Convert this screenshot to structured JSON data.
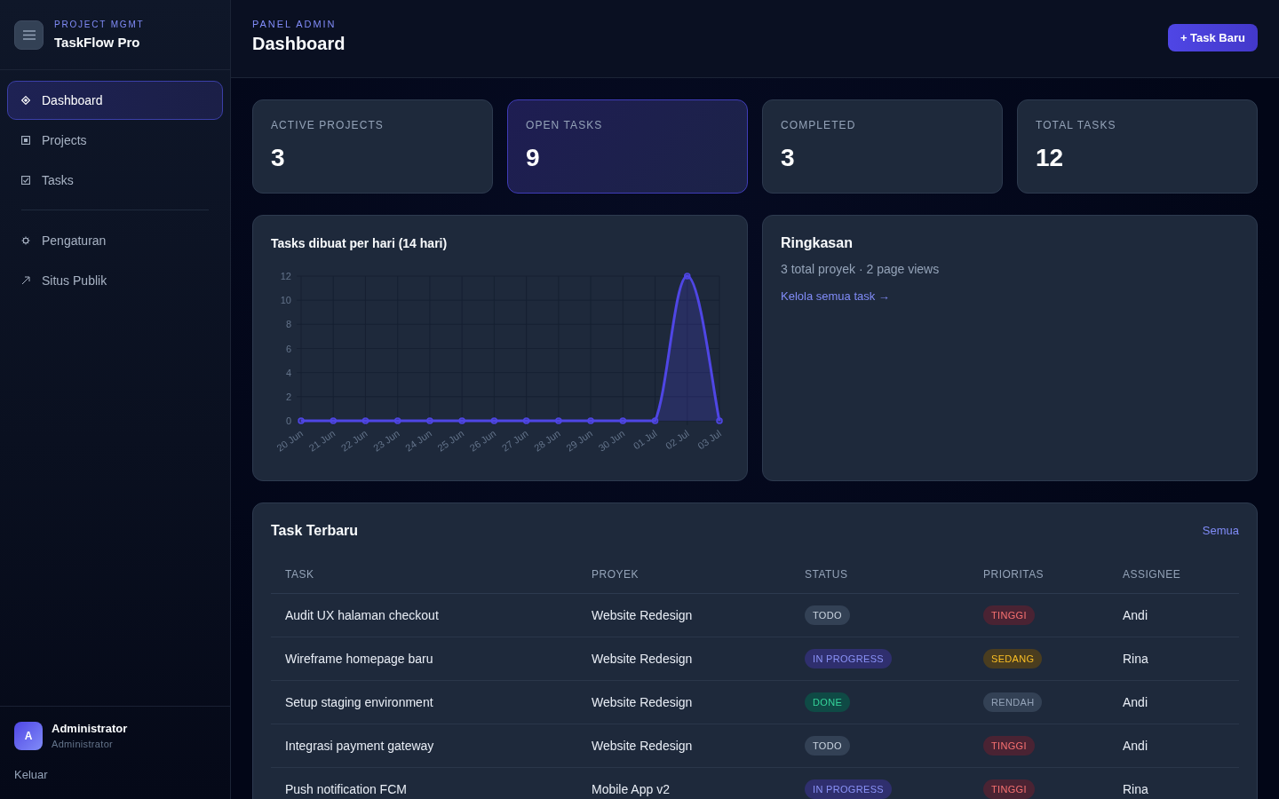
{
  "sidebar": {
    "brand": {
      "eyebrow": "PROJECT MGMT",
      "name": "TaskFlow Pro"
    },
    "nav": [
      {
        "label": "Dashboard",
        "selected": true
      },
      {
        "label": "Projects",
        "selected": false
      },
      {
        "label": "Tasks",
        "selected": false
      }
    ],
    "secondary_nav": [
      {
        "label": "Pengaturan",
        "selected": false
      },
      {
        "label": "Situs Publik",
        "selected": false
      }
    ],
    "user": {
      "initial": "A",
      "name": "Administrator",
      "role": "Administrator"
    },
    "logout": "Keluar"
  },
  "header": {
    "eyebrow": "PANEL ADMIN",
    "title": "Dashboard",
    "action": "+ Task Baru"
  },
  "stats": [
    {
      "label": "ACTIVE PROJECTS",
      "value": "3",
      "highlighted": false
    },
    {
      "label": "OPEN TASKS",
      "value": "9",
      "highlighted": true
    },
    {
      "label": "COMPLETED",
      "value": "3",
      "highlighted": false
    },
    {
      "label": "TOTAL TASKS",
      "value": "12",
      "highlighted": false
    }
  ],
  "chart_card": {
    "chart_data": {
      "type": "area",
      "title": "Tasks dibuat per hari (14 hari)",
      "categories": [
        "20 Jun",
        "21 Jun",
        "22 Jun",
        "23 Jun",
        "24 Jun",
        "25 Jun",
        "26 Jun",
        "27 Jun",
        "28 Jun",
        "29 Jun",
        "30 Jun",
        "01 Jul",
        "02 Jul",
        "03 Jul"
      ],
      "series": [
        {
          "color": "#4f46e5",
          "values": [
            0,
            0,
            0,
            0,
            0,
            0,
            0,
            0,
            0,
            0,
            0,
            0,
            12,
            0
          ]
        }
      ],
      "ylim": [
        0,
        12
      ],
      "yticks": [
        0,
        2,
        4,
        6,
        8,
        10,
        12
      ],
      "grid": true
    }
  },
  "summary": {
    "title": "Ringkasan",
    "text": "3 total proyek · 2 page views",
    "link": "Kelola semua task →"
  },
  "recent_tasks": {
    "title": "Task Terbaru",
    "link": "Semua",
    "columns": [
      "TASK",
      "PROYEK",
      "STATUS",
      "PRIORITAS",
      "ASSIGNEE"
    ],
    "rows": [
      {
        "task": "Audit UX halaman checkout",
        "project": "Website Redesign",
        "status": {
          "label": "TODO",
          "kind": "todo"
        },
        "priority": {
          "label": "TINGGI",
          "kind": "high"
        },
        "assignee": "Andi"
      },
      {
        "task": "Wireframe homepage baru",
        "project": "Website Redesign",
        "status": {
          "label": "IN PROGRESS",
          "kind": "in_progress"
        },
        "priority": {
          "label": "SEDANG",
          "kind": "medium"
        },
        "assignee": "Rina"
      },
      {
        "task": "Setup staging environment",
        "project": "Website Redesign",
        "status": {
          "label": "DONE",
          "kind": "done"
        },
        "priority": {
          "label": "RENDAH",
          "kind": "low"
        },
        "assignee": "Andi"
      },
      {
        "task": "Integrasi payment gateway",
        "project": "Website Redesign",
        "status": {
          "label": "TODO",
          "kind": "todo"
        },
        "priority": {
          "label": "TINGGI",
          "kind": "high"
        },
        "assignee": "Andi"
      },
      {
        "task": "Push notification FCM",
        "project": "Mobile App v2",
        "status": {
          "label": "IN PROGRESS",
          "kind": "in_progress"
        },
        "priority": {
          "label": "TINGGI",
          "kind": "high"
        },
        "assignee": "Rina"
      }
    ]
  }
}
